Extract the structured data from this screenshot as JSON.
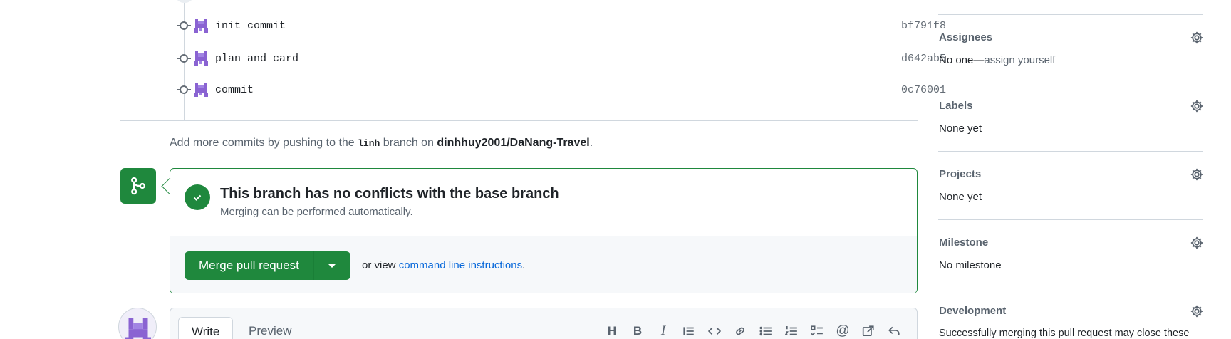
{
  "commits": [
    {
      "message": "init commit",
      "sha": "bf791f8"
    },
    {
      "message": "plan and card",
      "sha": "d642ab5"
    },
    {
      "message": "commit",
      "sha": "0c76001"
    }
  ],
  "add_commits": {
    "prefix": "Add more commits by pushing to the ",
    "branch": "linh",
    "middle": " branch on ",
    "repo": "dinhhuy2001/DaNang-Travel",
    "suffix": "."
  },
  "merge": {
    "title": "This branch has no conflicts with the base branch",
    "subtitle": "Merging can be performed automatically.",
    "button_label": "Merge pull request",
    "or_view": "or view ",
    "cli_link": "command line instructions",
    "period": "."
  },
  "editor": {
    "tab_write": "Write",
    "tab_preview": "Preview",
    "toolbar_icons": [
      "heading-icon",
      "bold-icon",
      "italic-icon",
      "quote-icon",
      "code-icon",
      "link-icon",
      "unordered-list-icon",
      "ordered-list-icon",
      "task-list-icon",
      "mention-icon",
      "cross-reference-icon",
      "reply-icon"
    ]
  },
  "sidebar": {
    "assignees": {
      "title": "Assignees",
      "value_prefix": "No one—",
      "value_link": "assign yourself"
    },
    "labels": {
      "title": "Labels",
      "value": "None yet"
    },
    "projects": {
      "title": "Projects",
      "value": "None yet"
    },
    "milestone": {
      "title": "Milestone",
      "value": "No milestone"
    },
    "development": {
      "title": "Development",
      "value": "Successfully merging this pull request may close these"
    }
  },
  "colors": {
    "success": "#1f883d",
    "link": "#0969da",
    "muted": "#59636e",
    "avatar": "#8a63d2"
  }
}
